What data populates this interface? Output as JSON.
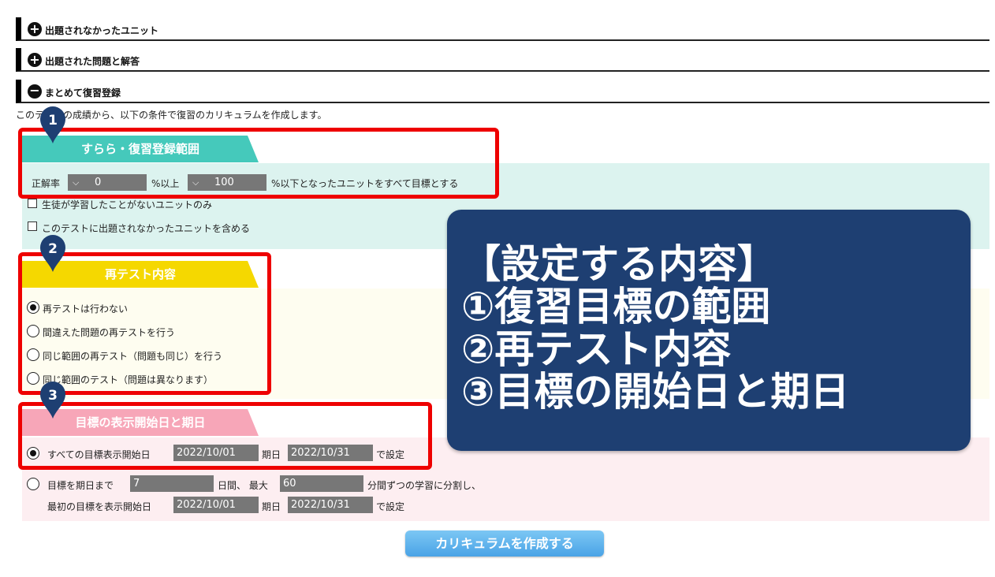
{
  "accordions": [
    {
      "label": "出題されなかったユニット",
      "icon": "plus-circle-icon",
      "symbol": "+"
    },
    {
      "label": "出題された問題と解答",
      "icon": "plus-circle-icon",
      "symbol": "+"
    },
    {
      "label": "まとめて復習登録",
      "icon": "minus-circle-icon",
      "symbol": "−"
    }
  ],
  "intro": "このテストの成績から、以下の条件で復習のカリキュラムを作成します。",
  "section1": {
    "number": "1",
    "header": "すらら・復習登録範囲",
    "header_color": "#45c9bb",
    "band_color": "#dcf3ef",
    "rate_label": "正解率",
    "min_value": "0",
    "min_suffix": "%以上",
    "max_value": "100",
    "max_suffix": "%以下となったユニットをすべて目標とする",
    "checkbox1": "生徒が学習したことがないユニットのみ",
    "checkbox2": "このテストに出題されなかったユニットを含める"
  },
  "section2": {
    "number": "2",
    "header": "再テスト内容",
    "header_color": "#f5d800",
    "band_color": "#fefdf0",
    "options": [
      {
        "label": "再テストは行わない",
        "selected": true
      },
      {
        "label": "間違えた問題の再テストを行う",
        "selected": false
      },
      {
        "label": "同じ範囲の再テスト（問題も同じ）を行う",
        "selected": false
      },
      {
        "label": "同じ範囲のテスト（問題は異なります）",
        "selected": false
      }
    ]
  },
  "section3": {
    "number": "3",
    "header": "目標の表示開始日と期日",
    "header_color": "#f7a6b8",
    "band_color": "#fdeef1",
    "opt1": {
      "label": "すべての目標表示開始日",
      "start": "2022/10/01",
      "due_label": "期日",
      "due": "2022/10/31",
      "suffix": "で設定",
      "selected": true
    },
    "opt2": {
      "label": "目標を期日まで",
      "days": "7",
      "days_suffix": "日間、 最大",
      "minutes": "60",
      "minutes_suffix": "分間ずつの学習に分割し、",
      "start_label": "最初の目標を表示開始日",
      "start": "2022/10/01",
      "due_label": "期日",
      "due": "2022/10/31",
      "suffix": "で設定",
      "selected": false
    }
  },
  "create_button": "カリキュラムを作成する",
  "overlay": {
    "lines": [
      "【設定する内容】",
      "①復習目標の範囲",
      "②再テスト内容",
      "③目標の開始日と期日"
    ]
  },
  "colors": {
    "highlight": "#ee0000",
    "pin": "#1e3f72",
    "overlay": "#1e3f72"
  }
}
